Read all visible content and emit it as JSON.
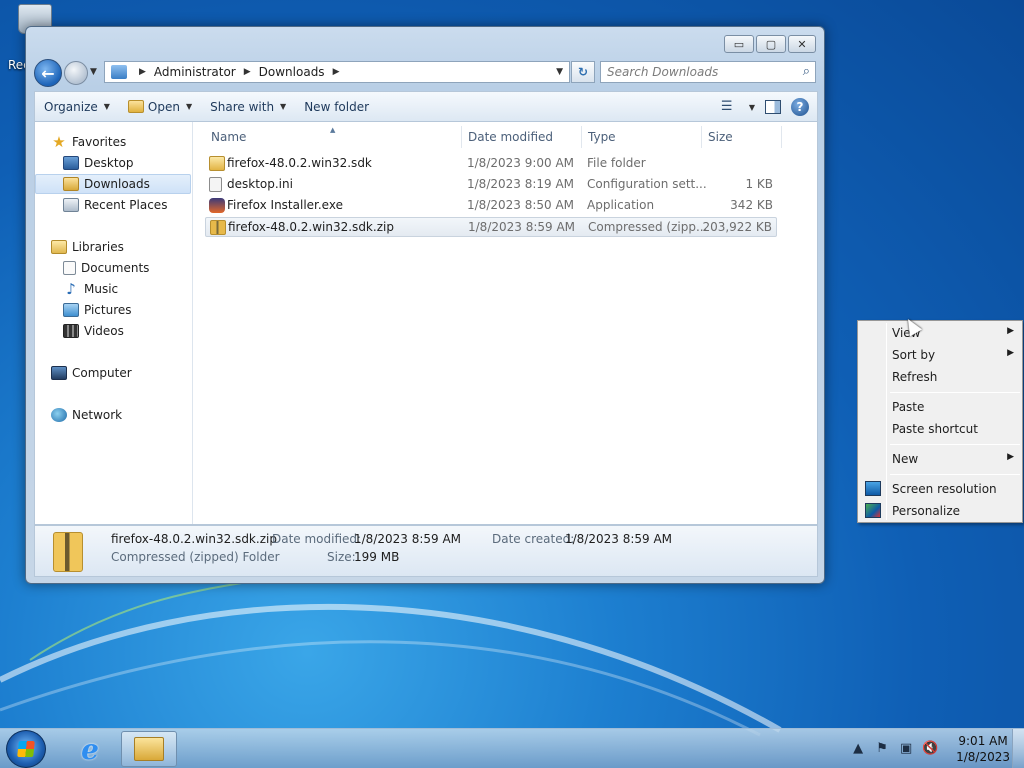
{
  "desktop": {
    "recycle_bin_label": "Rec"
  },
  "window": {
    "caption_buttons": {
      "minimize": "▭",
      "maximize": "▢",
      "close": "✕"
    },
    "address": {
      "crumbs": [
        "Administrator",
        "Downloads"
      ]
    },
    "search": {
      "placeholder": "Search Downloads"
    },
    "toolbar": {
      "organize": "Organize",
      "open": "Open",
      "share_with": "Share with",
      "new_folder": "New folder"
    },
    "nav_pane": {
      "favorites": "Favorites",
      "desktop": "Desktop",
      "downloads": "Downloads",
      "recent_places": "Recent Places",
      "libraries": "Libraries",
      "documents": "Documents",
      "music": "Music",
      "pictures": "Pictures",
      "videos": "Videos",
      "computer": "Computer",
      "network": "Network"
    },
    "columns": {
      "name": "Name",
      "date_modified": "Date modified",
      "type": "Type",
      "size": "Size"
    },
    "files": [
      {
        "name": "firefox-48.0.2.win32.sdk",
        "date": "1/8/2023 9:00 AM",
        "type": "File folder",
        "size": "",
        "icon": "folder-icon"
      },
      {
        "name": "desktop.ini",
        "date": "1/8/2023 8:19 AM",
        "type": "Configuration sett...",
        "size": "1 KB",
        "icon": "ini-file-icon"
      },
      {
        "name": "Firefox Installer.exe",
        "date": "1/8/2023 8:50 AM",
        "type": "Application",
        "size": "342 KB",
        "icon": "firefox-icon"
      },
      {
        "name": "firefox-48.0.2.win32.sdk.zip",
        "date": "1/8/2023 8:59 AM",
        "type": "Compressed (zipp...",
        "size": "203,922 KB",
        "icon": "zip-icon"
      }
    ],
    "details": {
      "name": "firefox-48.0.2.win32.sdk.zip",
      "kind": "Compressed (zipped) Folder",
      "date_modified_label": "Date modified:",
      "date_modified": "1/8/2023 8:59 AM",
      "date_created_label": "Date created:",
      "date_created": "1/8/2023 8:59 AM",
      "size_label": "Size:",
      "size": "199 MB"
    }
  },
  "context_menu": {
    "view": "View",
    "sort_by": "Sort by",
    "refresh": "Refresh",
    "paste": "Paste",
    "paste_shortcut": "Paste shortcut",
    "new": "New",
    "screen_resolution": "Screen resolution",
    "personalize": "Personalize",
    "submenu_arrow": "▶"
  },
  "taskbar": {
    "time": "9:01 AM",
    "date": "1/8/2023",
    "tray_expand": "▲"
  }
}
